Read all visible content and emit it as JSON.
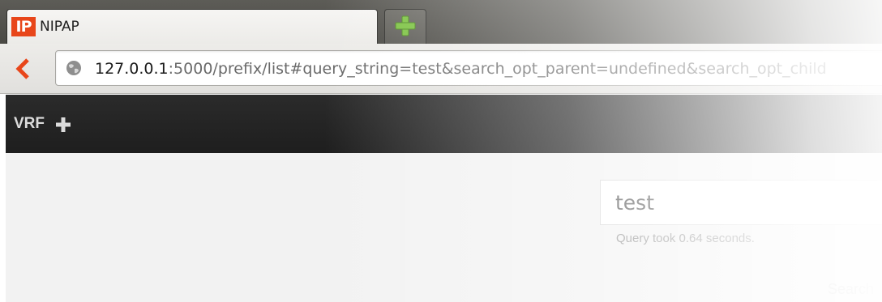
{
  "browser": {
    "tab": {
      "favicon_text": "IP",
      "title": "NIPAP"
    },
    "url": {
      "host": "127.0.0.1",
      "rest": ":5000/prefix/list#query_string=test&search_opt_parent=undefined&search_opt_child"
    }
  },
  "app": {
    "topbar": {
      "vrf_label": "VRF"
    },
    "search": {
      "value": "test",
      "query_time": "Query took 0.64 seconds.",
      "button_label": "Search"
    }
  },
  "colors": {
    "favicon_bg": "#e8461a",
    "newtab_plus": "#7cc242",
    "back_arrow": "#e8461a",
    "appbar_bg": "#262626"
  },
  "icons": {
    "back": "back-arrow-icon",
    "newtab": "plus-icon",
    "site": "globe-icon",
    "vrf_add": "plus-icon"
  }
}
